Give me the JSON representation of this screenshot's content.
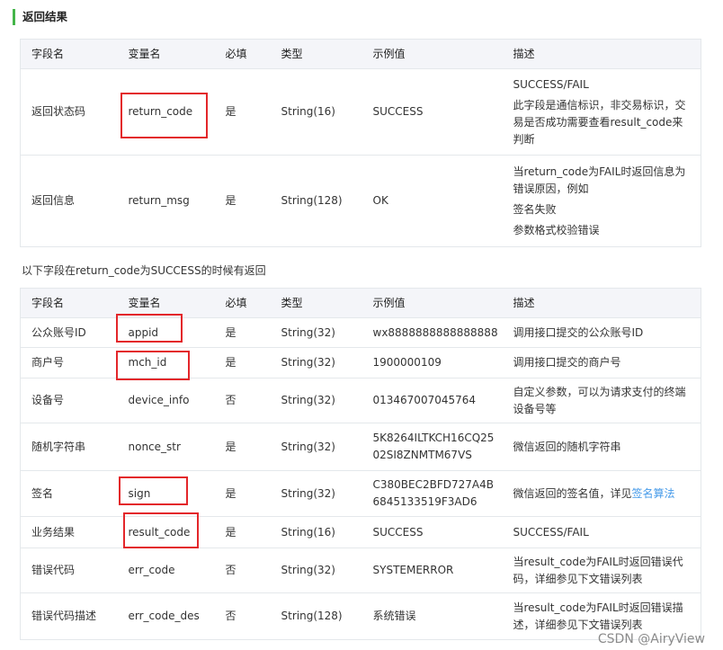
{
  "section_title": "返回结果",
  "note": "以下字段在return_code为SUCCESS的时候有返回",
  "headers": [
    "字段名",
    "变量名",
    "必填",
    "类型",
    "示例值",
    "描述"
  ],
  "table1": [
    {
      "field": "返回状态码",
      "var": "return_code",
      "required": "是",
      "type": "String(16)",
      "example": "SUCCESS",
      "desc": [
        "SUCCESS/FAIL",
        "此字段是通信标识，非交易标识，交易是否成功需要查看result_code来判断"
      ]
    },
    {
      "field": "返回信息",
      "var": "return_msg",
      "required": "是",
      "type": "String(128)",
      "example": "OK",
      "desc": [
        "当return_code为FAIL时返回信息为错误原因，例如",
        "签名失败",
        "参数格式校验错误"
      ]
    }
  ],
  "table2": [
    {
      "field": "公众账号ID",
      "var": "appid",
      "required": "是",
      "type": "String(32)",
      "example": "wx8888888888888888",
      "desc": "调用接口提交的公众账号ID"
    },
    {
      "field": "商户号",
      "var": "mch_id",
      "required": "是",
      "type": "String(32)",
      "example": "1900000109",
      "desc": "调用接口提交的商户号"
    },
    {
      "field": "设备号",
      "var": "device_info",
      "required": "否",
      "type": "String(32)",
      "example": "013467007045764",
      "desc": "自定义参数，可以为请求支付的终端设备号等"
    },
    {
      "field": "随机字符串",
      "var": "nonce_str",
      "required": "是",
      "type": "String(32)",
      "example": "5K8264ILTKCH16CQ2502SI8ZNMTM67VS",
      "desc": "微信返回的随机字符串"
    },
    {
      "field": "签名",
      "var": "sign",
      "required": "是",
      "type": "String(32)",
      "example": "C380BEC2BFD727A4B6845133519F3AD6",
      "desc": "微信返回的签名值，详见",
      "desc_link": "签名算法"
    },
    {
      "field": "业务结果",
      "var": "result_code",
      "required": "是",
      "type": "String(16)",
      "example": "SUCCESS",
      "desc": "SUCCESS/FAIL"
    },
    {
      "field": "错误代码",
      "var": "err_code",
      "required": "否",
      "type": "String(32)",
      "example": "SYSTEMERROR",
      "desc": "当result_code为FAIL时返回错误代码，详细参见下文错误列表"
    },
    {
      "field": "错误代码描述",
      "var": "err_code_des",
      "required": "否",
      "type": "String(128)",
      "example": "系统错误",
      "desc": "当result_code为FAIL时返回错误描述，详细参见下文错误列表"
    }
  ],
  "watermark": "CSDN @AiryView",
  "colors": {
    "accent_bar": "#44b549",
    "highlight_box": "#e3262a",
    "link": "#459ae9",
    "header_bg": "#f4f5f9"
  }
}
